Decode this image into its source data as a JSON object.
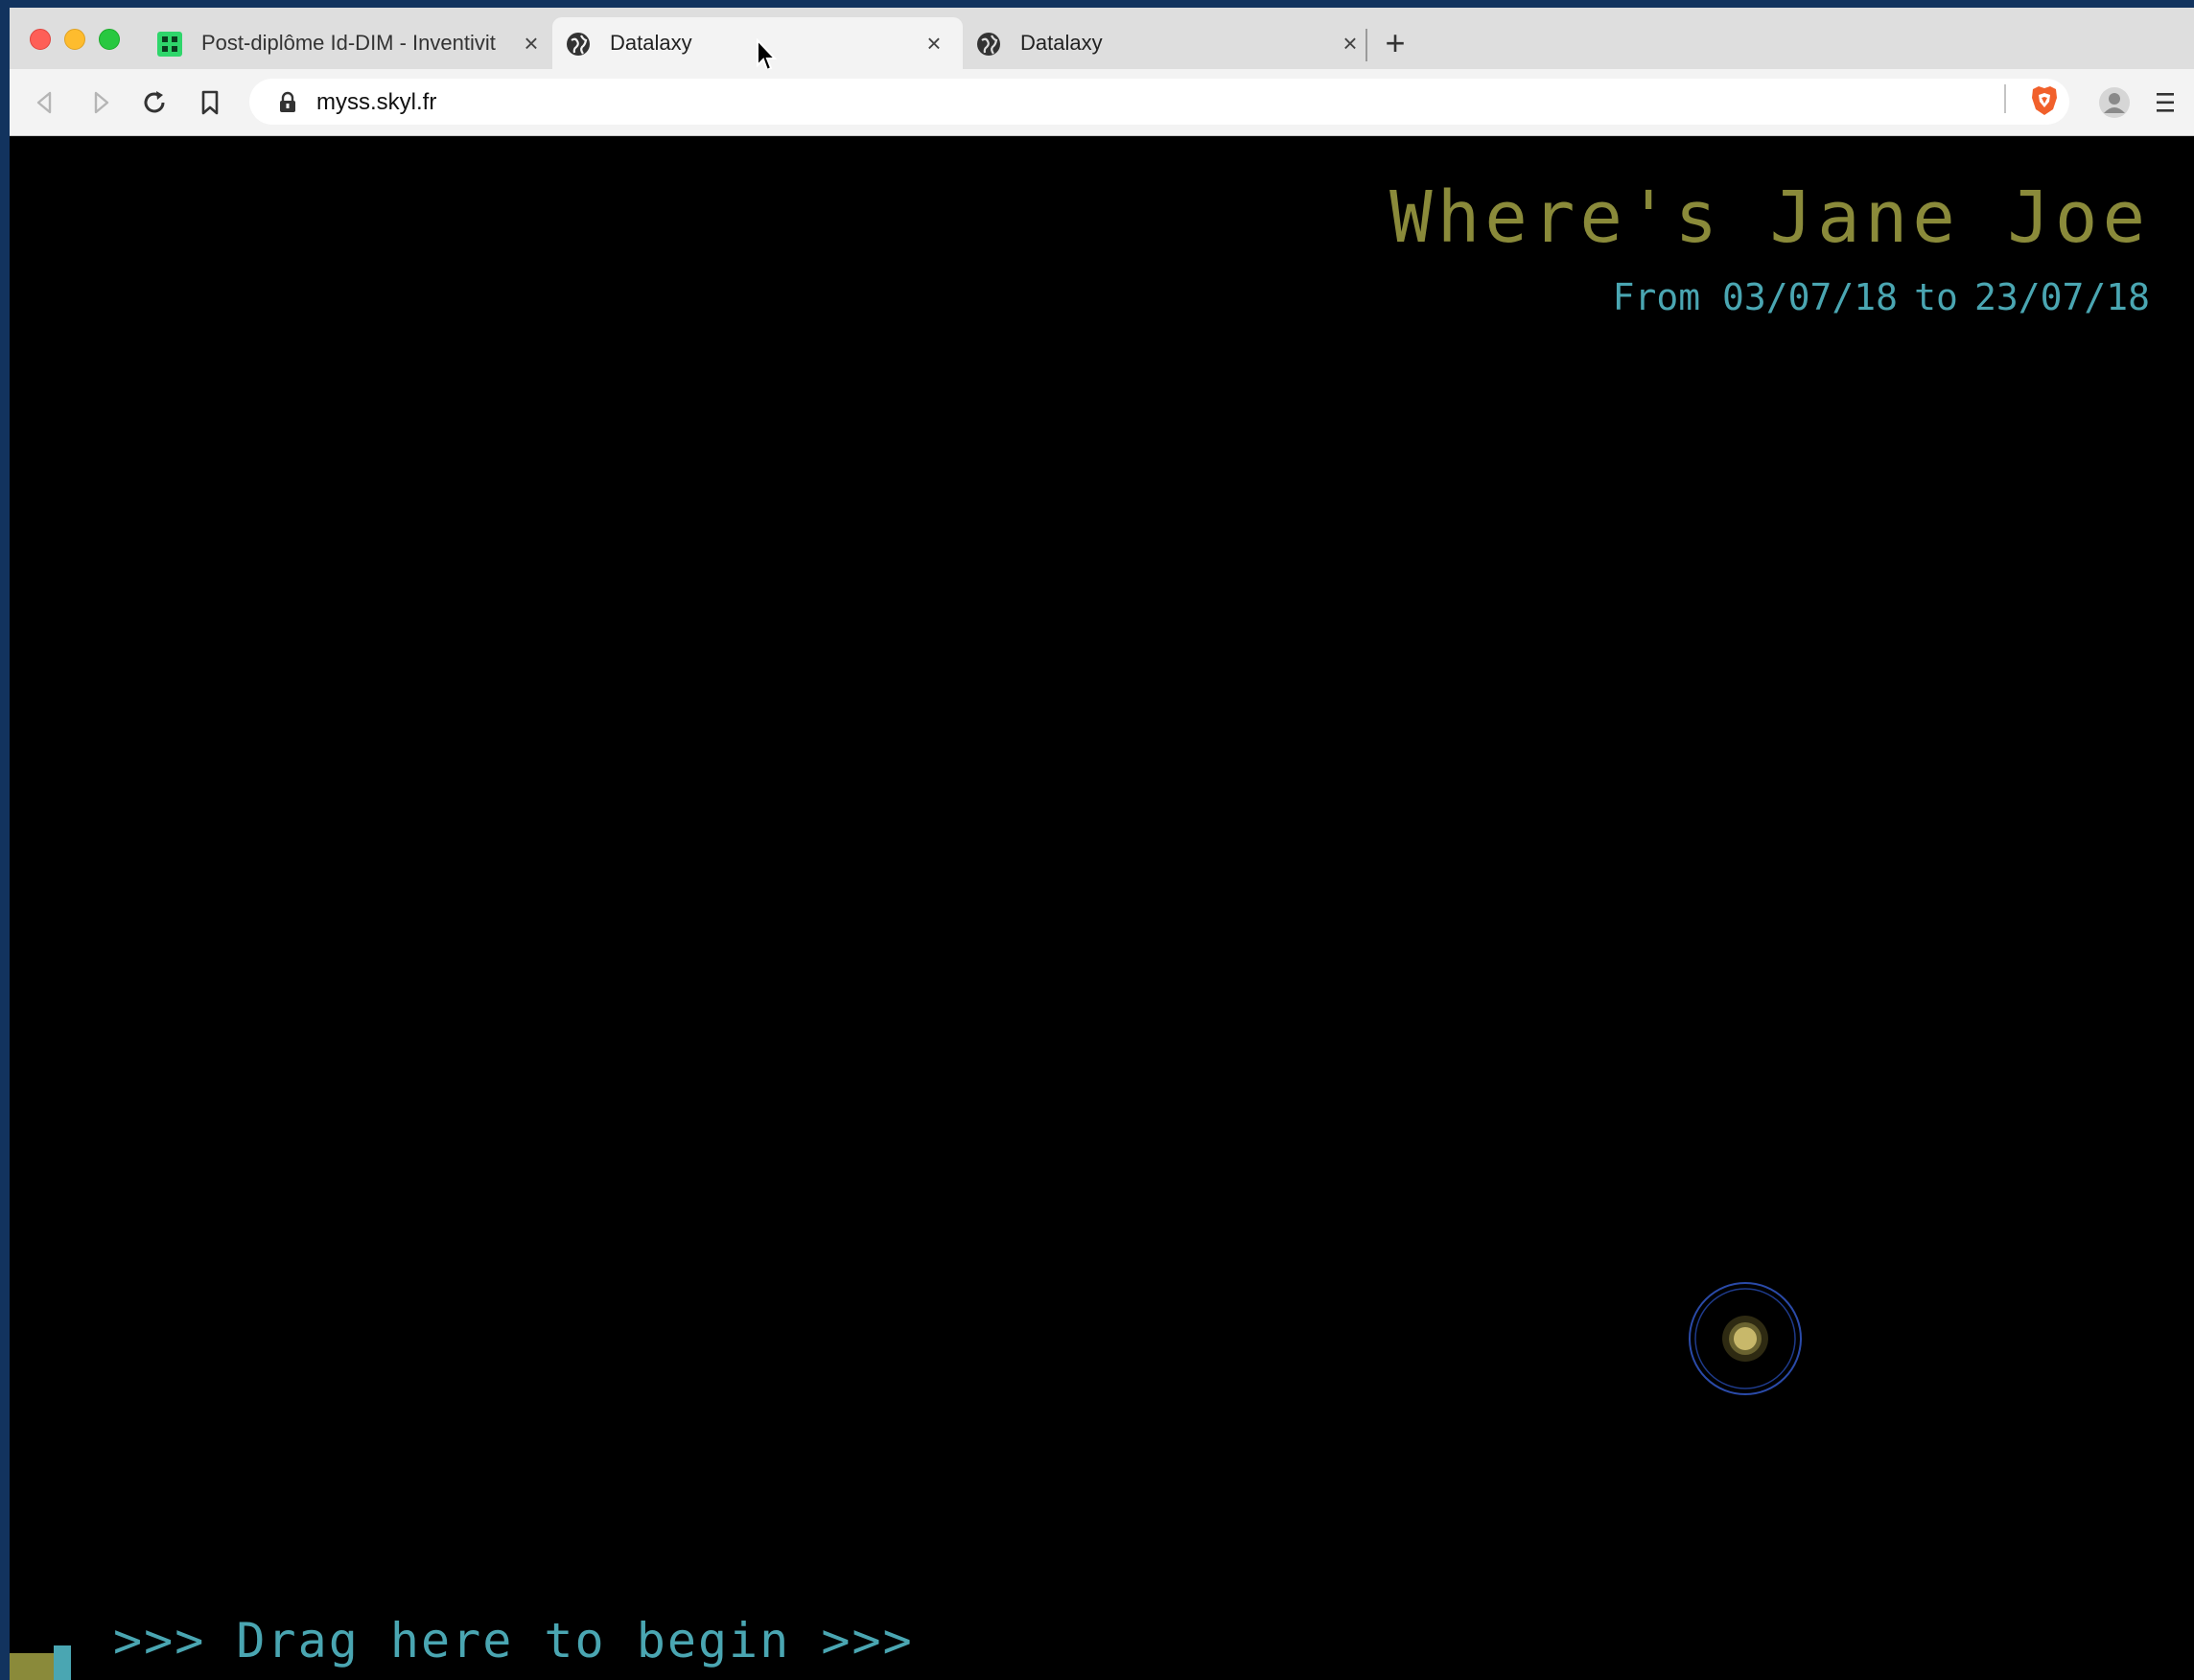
{
  "browser": {
    "tabs": [
      {
        "title": "Post-diplôme Id-DIM - Inventivit",
        "active": false,
        "favicon": "green-grid-favicon"
      },
      {
        "title": "Datalaxy",
        "active": true,
        "favicon": "globe-icon"
      },
      {
        "title": "Datalaxy",
        "active": false,
        "favicon": "globe-icon"
      }
    ],
    "url": "myss.skyl.fr"
  },
  "page": {
    "title": "Where's Jane Joe",
    "date_from_label": "From",
    "date_from": "03/07/18",
    "date_to_label": "to",
    "date_to": "23/07/18",
    "drag_hint": ">>> Drag here to begin >>>"
  },
  "colors": {
    "title": "#8a8a3a",
    "accent": "#4aa6b2",
    "star_core": "#c8b86a",
    "star_ring": "#2a4aa8",
    "desktop": "#12335e"
  }
}
